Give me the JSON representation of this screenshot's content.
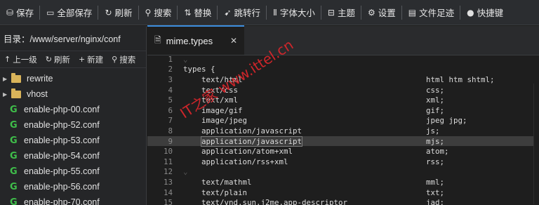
{
  "toolbar": {
    "items": [
      {
        "icon": "save-icon",
        "label": "保存"
      },
      {
        "icon": "save-all-icon",
        "label": "全部保存"
      },
      {
        "icon": "refresh-icon",
        "label": "刷新"
      },
      {
        "icon": "search-icon",
        "label": "搜索"
      },
      {
        "icon": "replace-icon",
        "label": "替换"
      },
      {
        "icon": "goto-line-icon",
        "label": "跳转行"
      },
      {
        "icon": "font-size-icon",
        "label": "字体大小"
      },
      {
        "icon": "theme-icon",
        "label": "主题"
      },
      {
        "icon": "settings-icon",
        "label": "设置"
      },
      {
        "icon": "file-footprint-icon",
        "label": "文件足迹"
      },
      {
        "icon": "shortcut-icon",
        "label": "快捷键"
      }
    ]
  },
  "sidebar": {
    "directory_label": "目录：/www/server/nginx/conf",
    "actions": [
      {
        "icon": "up-level-icon",
        "label": "上一级"
      },
      {
        "icon": "refresh-icon",
        "label": "刷新"
      },
      {
        "icon": "plus-icon",
        "label": "新建"
      },
      {
        "icon": "search-icon",
        "label": "搜索"
      }
    ],
    "tree": [
      {
        "type": "folder",
        "name": "rewrite"
      },
      {
        "type": "folder",
        "name": "vhost"
      },
      {
        "type": "file",
        "name": "enable-php-00.conf"
      },
      {
        "type": "file",
        "name": "enable-php-52.conf"
      },
      {
        "type": "file",
        "name": "enable-php-53.conf"
      },
      {
        "type": "file",
        "name": "enable-php-54.conf"
      },
      {
        "type": "file",
        "name": "enable-php-55.conf"
      },
      {
        "type": "file",
        "name": "enable-php-56.conf"
      },
      {
        "type": "file",
        "name": "enable-php-70.conf"
      }
    ]
  },
  "editor": {
    "active_tab": "mime.types",
    "lines": [
      {
        "n": "1",
        "text": "",
        "value": "",
        "indent": false,
        "fold": true
      },
      {
        "n": "2",
        "text": "types {",
        "value": "",
        "indent": false,
        "fold": false
      },
      {
        "n": "3",
        "text": "text/html",
        "value": "html htm shtml;",
        "indent": true,
        "fold": false
      },
      {
        "n": "4",
        "text": "text/css",
        "value": "css;",
        "indent": true,
        "fold": false
      },
      {
        "n": "5",
        "text": "text/xml",
        "value": "xml;",
        "indent": true,
        "fold": false
      },
      {
        "n": "6",
        "text": "image/gif",
        "value": "gif;",
        "indent": true,
        "fold": false
      },
      {
        "n": "7",
        "text": "image/jpeg",
        "value": "jpeg jpg;",
        "indent": true,
        "fold": false
      },
      {
        "n": "8",
        "text": "application/javascript",
        "value": "js;",
        "indent": true,
        "fold": false
      },
      {
        "n": "9",
        "text": "application/javascript",
        "value": "mjs;",
        "indent": true,
        "fold": false,
        "highlighted": true
      },
      {
        "n": "10",
        "text": "application/atom+xml",
        "value": "atom;",
        "indent": true,
        "fold": false
      },
      {
        "n": "11",
        "text": "application/rss+xml",
        "value": "rss;",
        "indent": true,
        "fold": false
      },
      {
        "n": "12",
        "text": "",
        "value": "",
        "indent": false,
        "fold": true
      },
      {
        "n": "13",
        "text": "text/mathml",
        "value": "mml;",
        "indent": true,
        "fold": false
      },
      {
        "n": "14",
        "text": "text/plain",
        "value": "txt;",
        "indent": true,
        "fold": false
      },
      {
        "n": "15",
        "text": "text/vnd.sun.j2me.app-descriptor",
        "value": "jad;",
        "indent": true,
        "fold": false
      }
    ]
  },
  "watermark": "IT之家 www.ittel.cn",
  "colors": {
    "accent": "#3c8dde",
    "folder": "#d9b45a",
    "conf_icon": "#3fbf4a",
    "watermark": "#d7262b"
  }
}
